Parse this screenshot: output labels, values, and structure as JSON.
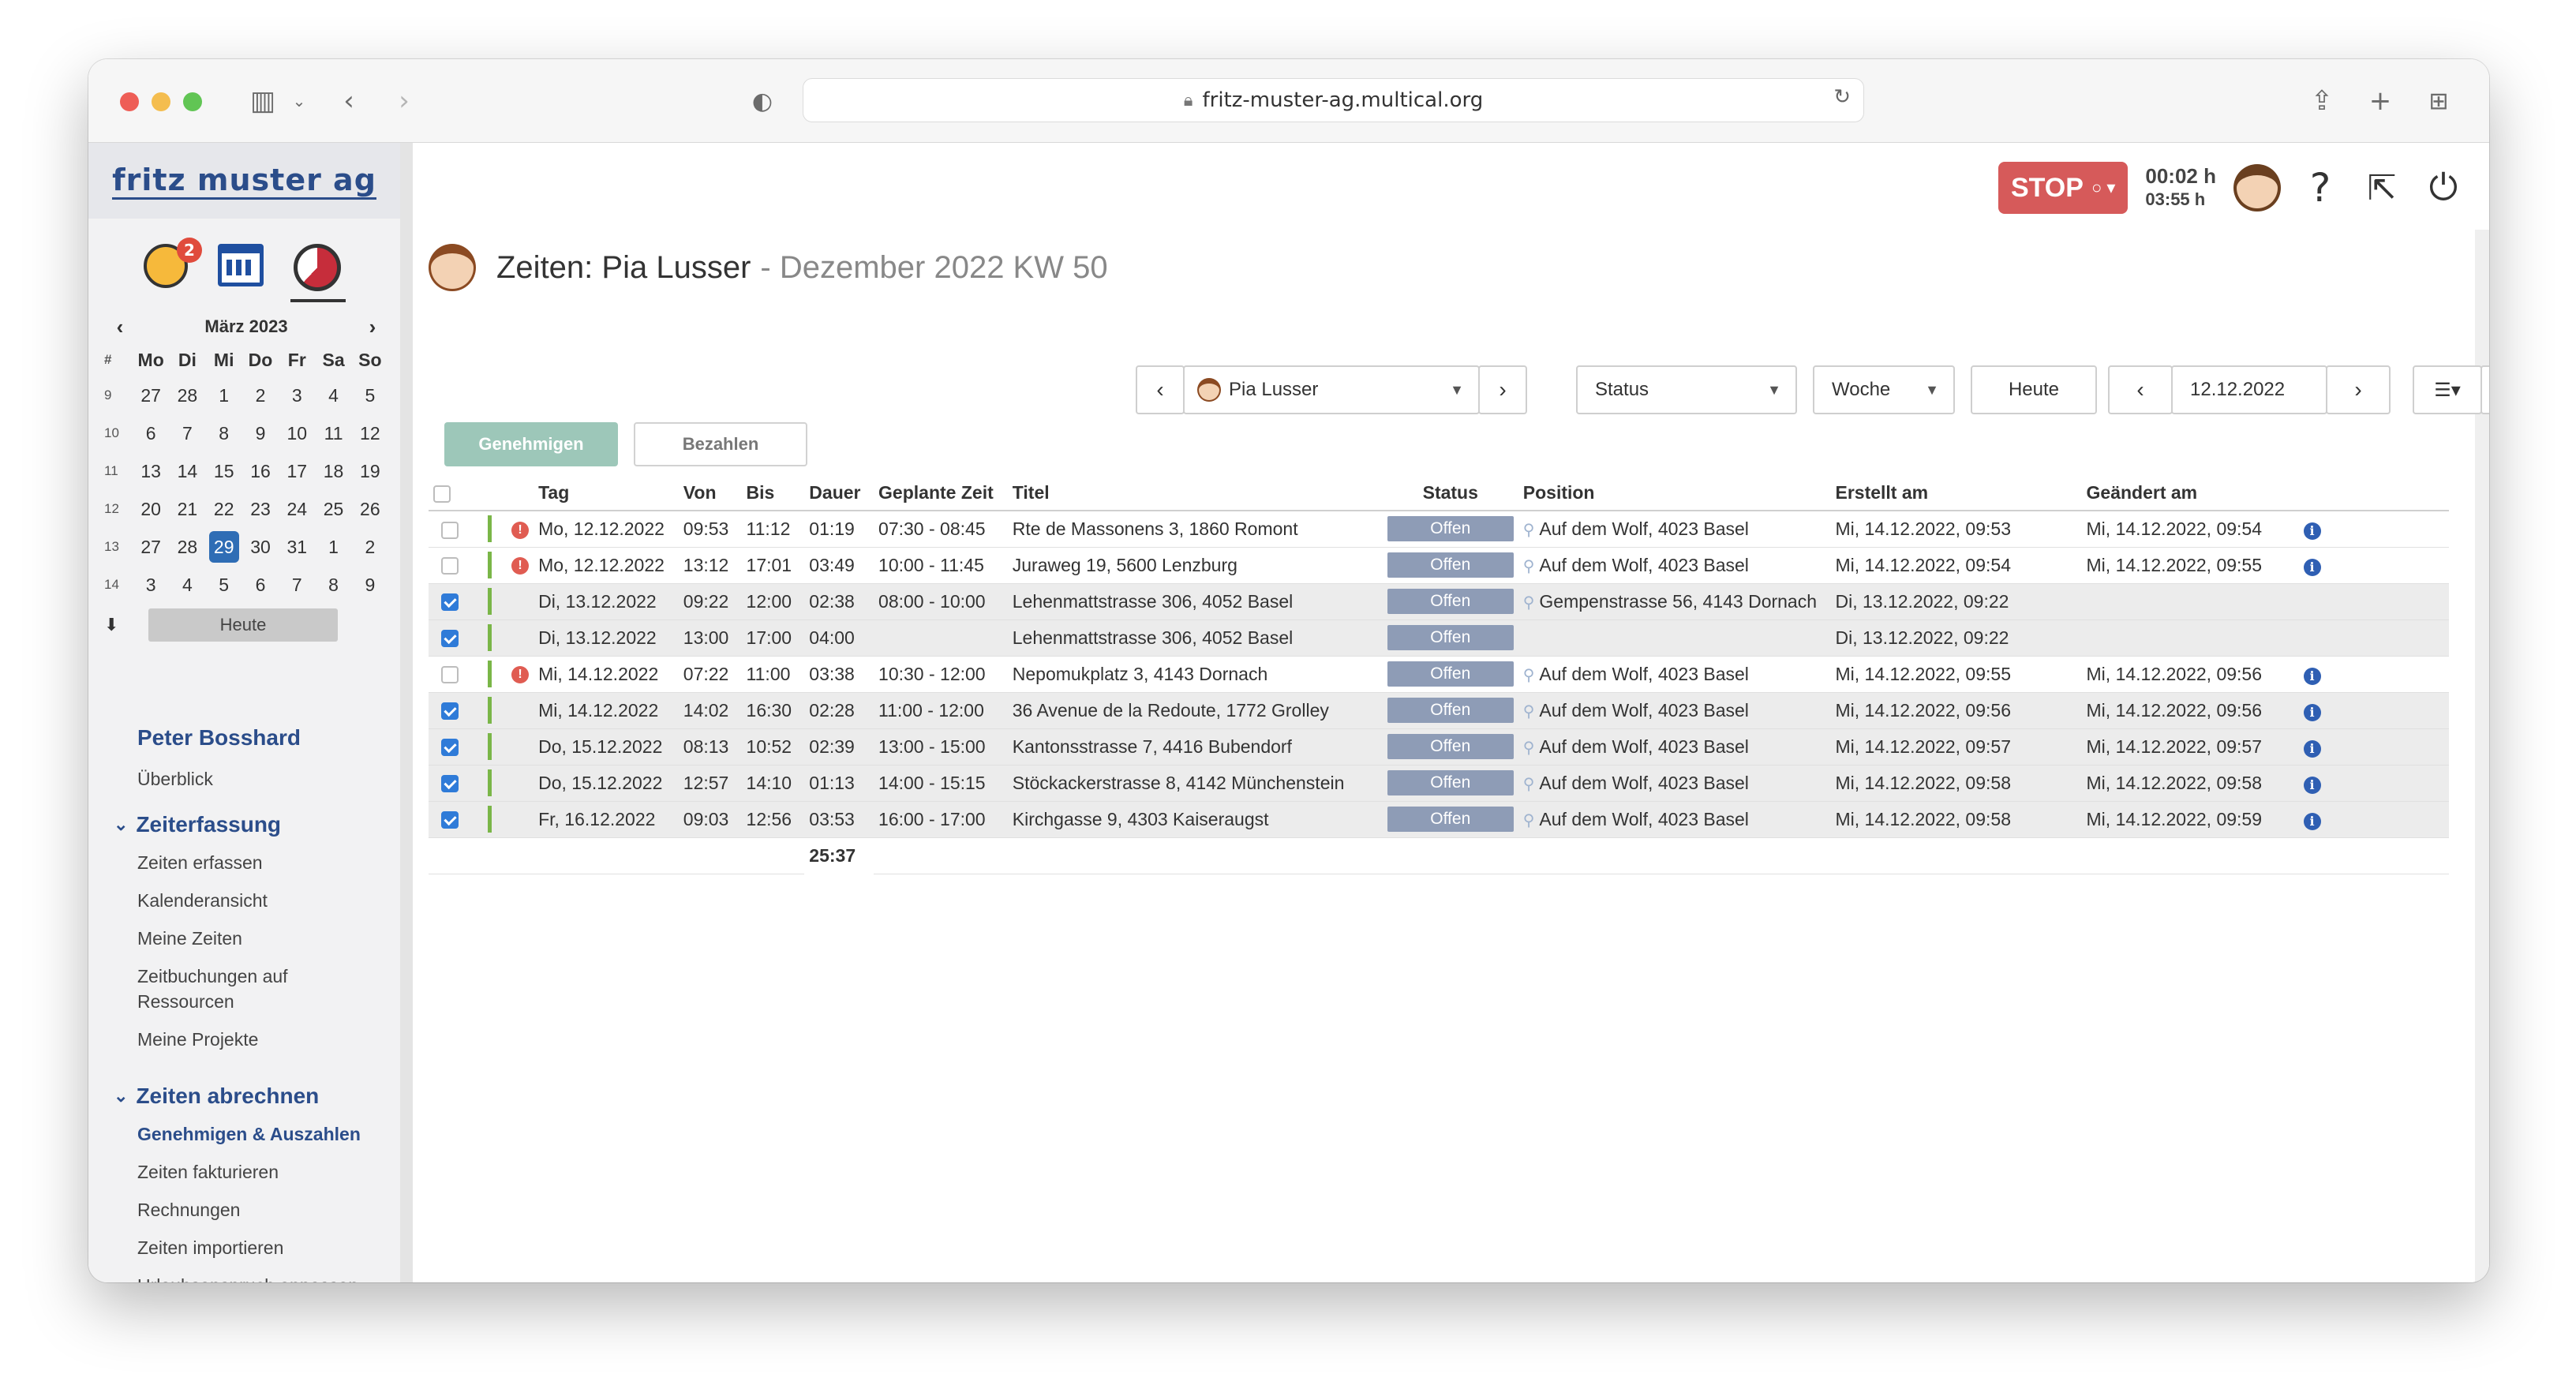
{
  "browser": {
    "url": "fritz-muster-ag.multical.org"
  },
  "sidebar": {
    "logo": "fritz muster ag",
    "badge_count": "2",
    "calendar": {
      "month_label": "März 2023",
      "headers": [
        "#",
        "Mo",
        "Di",
        "Mi",
        "Do",
        "Fr",
        "Sa",
        "So"
      ],
      "weeks": [
        {
          "wk": "9",
          "days": [
            "27",
            "28",
            "1",
            "2",
            "3",
            "4",
            "5"
          ]
        },
        {
          "wk": "10",
          "days": [
            "6",
            "7",
            "8",
            "9",
            "10",
            "11",
            "12"
          ]
        },
        {
          "wk": "11",
          "days": [
            "13",
            "14",
            "15",
            "16",
            "17",
            "18",
            "19"
          ]
        },
        {
          "wk": "12",
          "days": [
            "20",
            "21",
            "22",
            "23",
            "24",
            "25",
            "26"
          ]
        },
        {
          "wk": "13",
          "days": [
            "27",
            "28",
            "29",
            "30",
            "31",
            "1",
            "2"
          ]
        },
        {
          "wk": "14",
          "days": [
            "3",
            "4",
            "5",
            "6",
            "7",
            "8",
            "9"
          ]
        }
      ],
      "today": "29",
      "today_button": "Heute"
    },
    "user_name": "Peter Bosshard",
    "overview_link": "Überblick",
    "group_zeiterfassung": "Zeiterfassung",
    "zeiterfassung_items": [
      "Zeiten erfassen",
      "Kalenderansicht",
      "Meine Zeiten",
      "Zeitbuchungen auf Ressourcen",
      "Meine Projekte"
    ],
    "group_abrechnen": "Zeiten abrechnen",
    "abrechnen_items": [
      "Genehmigen & Auszahlen",
      "Zeiten fakturieren",
      "Rechnungen",
      "Zeiten importieren",
      "Urlaubsanspruch anpassen"
    ]
  },
  "header": {
    "stop_label": "STOP",
    "timer_1": "00:02 h",
    "timer_2": "03:55 h",
    "help": "?"
  },
  "page": {
    "title": "Zeiten: Pia Lusser",
    "subtitle": "- Dezember 2022 KW 50"
  },
  "filters": {
    "person": "Pia Lusser",
    "status": "Status",
    "period": "Woche",
    "today": "Heute",
    "date": "12.12.2022"
  },
  "actions": {
    "approve": "Genehmigen",
    "pay": "Bezahlen"
  },
  "table": {
    "columns": [
      "Tag",
      "Von",
      "Bis",
      "Dauer",
      "Geplante Zeit",
      "Titel",
      "Status",
      "Position",
      "Erstellt am",
      "Geändert am"
    ],
    "rows": [
      {
        "checked": false,
        "warn": true,
        "tag": "Mo, 12.12.2022",
        "von": "09:53",
        "bis": "11:12",
        "dauer": "01:19",
        "geplant": "07:30 - 08:45",
        "titel": "Rte de Massonens 3, 1860 Romont",
        "status": "Offen",
        "position": "Auf dem Wolf, 4023 Basel",
        "erstellt": "Mi, 14.12.2022, 09:53",
        "geaendert": "Mi, 14.12.2022, 09:54",
        "info": true
      },
      {
        "checked": false,
        "warn": true,
        "tag": "Mo, 12.12.2022",
        "von": "13:12",
        "bis": "17:01",
        "dauer": "03:49",
        "geplant": "10:00 - 11:45",
        "titel": "Juraweg 19, 5600 Lenzburg",
        "status": "Offen",
        "position": "Auf dem Wolf, 4023 Basel",
        "erstellt": "Mi, 14.12.2022, 09:54",
        "geaendert": "Mi, 14.12.2022, 09:55",
        "info": true
      },
      {
        "checked": true,
        "warn": false,
        "tag": "Di, 13.12.2022",
        "von": "09:22",
        "bis": "12:00",
        "dauer": "02:38",
        "geplant": "08:00 - 10:00",
        "titel": "Lehenmattstrasse 306, 4052 Basel",
        "status": "Offen",
        "position": "Gempenstrasse 56, 4143 Dornach",
        "erstellt": "Di, 13.12.2022, 09:22",
        "geaendert": "",
        "info": false
      },
      {
        "checked": true,
        "warn": false,
        "tag": "Di, 13.12.2022",
        "von": "13:00",
        "bis": "17:00",
        "dauer": "04:00",
        "geplant": "",
        "titel": "Lehenmattstrasse 306, 4052 Basel",
        "status": "Offen",
        "position": "",
        "erstellt": "Di, 13.12.2022, 09:22",
        "geaendert": "",
        "info": false
      },
      {
        "checked": false,
        "warn": true,
        "tag": "Mi, 14.12.2022",
        "von": "07:22",
        "bis": "11:00",
        "dauer": "03:38",
        "geplant": "10:30 - 12:00",
        "titel": "Nepomukplatz 3, 4143 Dornach",
        "status": "Offen",
        "position": "Auf dem Wolf, 4023 Basel",
        "erstellt": "Mi, 14.12.2022, 09:55",
        "geaendert": "Mi, 14.12.2022, 09:56",
        "info": true
      },
      {
        "checked": true,
        "warn": false,
        "tag": "Mi, 14.12.2022",
        "von": "14:02",
        "bis": "16:30",
        "dauer": "02:28",
        "geplant": "11:00 - 12:00",
        "titel": "36 Avenue de la Redoute, 1772 Grolley",
        "status": "Offen",
        "position": "Auf dem Wolf, 4023 Basel",
        "erstellt": "Mi, 14.12.2022, 09:56",
        "geaendert": "Mi, 14.12.2022, 09:56",
        "info": true
      },
      {
        "checked": true,
        "warn": false,
        "tag": "Do, 15.12.2022",
        "von": "08:13",
        "bis": "10:52",
        "dauer": "02:39",
        "geplant": "13:00 - 15:00",
        "titel": "Kantonsstrasse 7, 4416 Bubendorf",
        "status": "Offen",
        "position": "Auf dem Wolf, 4023 Basel",
        "erstellt": "Mi, 14.12.2022, 09:57",
        "geaendert": "Mi, 14.12.2022, 09:57",
        "info": true
      },
      {
        "checked": true,
        "warn": false,
        "tag": "Do, 15.12.2022",
        "von": "12:57",
        "bis": "14:10",
        "dauer": "01:13",
        "geplant": "14:00 - 15:15",
        "titel": "Stöckackerstrasse 8, 4142 Münchenstein",
        "status": "Offen",
        "position": "Auf dem Wolf, 4023 Basel",
        "erstellt": "Mi, 14.12.2022, 09:58",
        "geaendert": "Mi, 14.12.2022, 09:58",
        "info": true
      },
      {
        "checked": true,
        "warn": false,
        "tag": "Fr, 16.12.2022",
        "von": "09:03",
        "bis": "12:56",
        "dauer": "03:53",
        "geplant": "16:00 - 17:00",
        "titel": "Kirchgasse 9, 4303 Kaiseraugst",
        "status": "Offen",
        "position": "Auf dem Wolf, 4023 Basel",
        "erstellt": "Mi, 14.12.2022, 09:58",
        "geaendert": "Mi, 14.12.2022, 09:59",
        "info": true
      }
    ],
    "total": "25:37"
  },
  "colors": {
    "accent": "#2b4d8a",
    "stop": "#d65a5a",
    "approve": "#9dc7b9",
    "status_pill": "#8e9cb6",
    "row_selected": "#ececec"
  }
}
